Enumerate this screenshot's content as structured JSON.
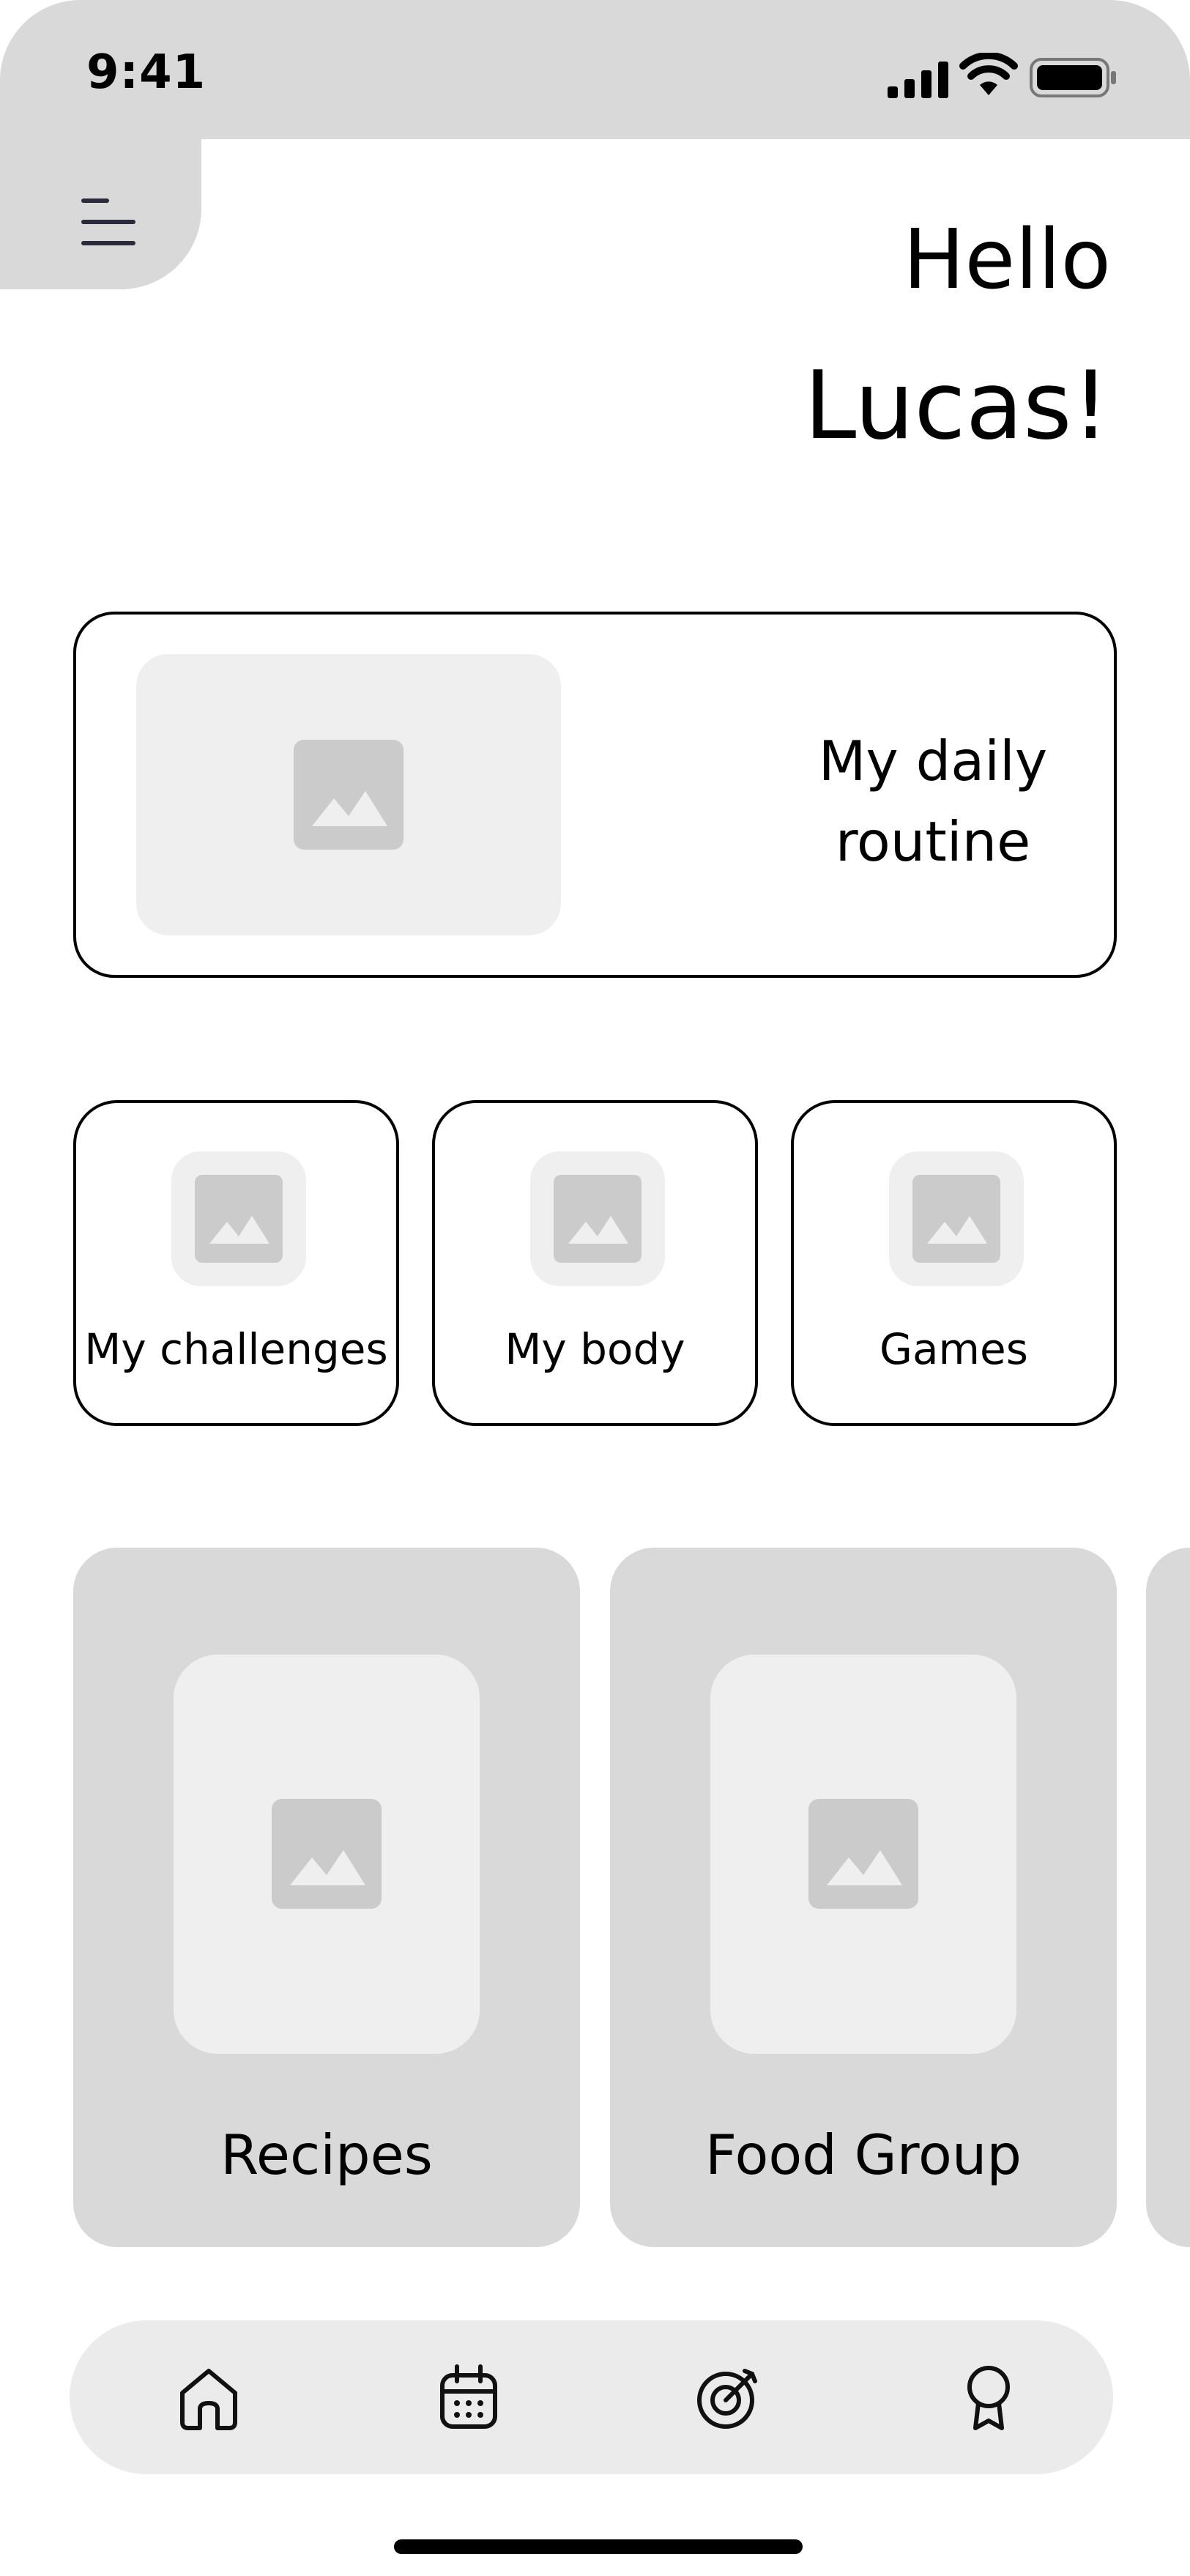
{
  "status_bar": {
    "time": "9:41",
    "icons": [
      "signal-icon",
      "wifi-icon",
      "battery-icon"
    ]
  },
  "header": {
    "menu_icon": "menu-icon",
    "greeting_line1": "Hello",
    "greeting_line2": "Lucas!"
  },
  "featured": {
    "line1": "My daily",
    "line2": "routine",
    "icon": "image-placeholder-icon"
  },
  "tiles": [
    {
      "label": "My challenges",
      "icon": "image-placeholder-icon"
    },
    {
      "label": "My body",
      "icon": "image-placeholder-icon"
    },
    {
      "label": "Games",
      "icon": "image-placeholder-icon"
    }
  ],
  "carousel": [
    {
      "label": "Recipes",
      "icon": "image-placeholder-icon"
    },
    {
      "label": "Food Group",
      "icon": "image-placeholder-icon"
    }
  ],
  "bottom_nav": {
    "items": [
      "home-icon",
      "calendar-icon",
      "target-icon",
      "award-icon"
    ]
  },
  "colors": {
    "panel": "#d9d9d9",
    "light_panel": "#efefef",
    "nav": "#ebebeb",
    "icon_fill": "#cbcbcb",
    "text": "#000000"
  }
}
